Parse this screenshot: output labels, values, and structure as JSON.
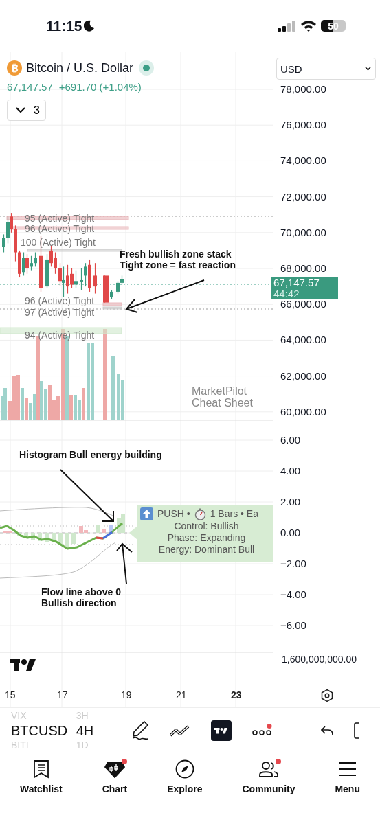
{
  "status_bar": {
    "time": "11:15",
    "battery": "50"
  },
  "symbol": {
    "title": "Bitcoin / U.S. Dollar",
    "market_open": true,
    "price": "67,147.57",
    "change": "+691.70 (+1.04%)",
    "indicator_count": "3",
    "currency": "USD"
  },
  "price_axis": [
    "78,000.00",
    "76,000.00",
    "74,000.00",
    "72,000.00",
    "70,000.00",
    "68,000.00",
    "66,000.00",
    "64,000.00",
    "62,000.00",
    "60,000.00"
  ],
  "last_price": {
    "price": "67,147.57",
    "countdown": "44:42"
  },
  "zones": [
    {
      "label": "95 (Active) Tight",
      "color": "#e8b4b8"
    },
    {
      "label": "96 (Active) Tight",
      "color": "#e8b4b8"
    },
    {
      "label": "100 (Active) Tight",
      "color": "#c9c9c9"
    },
    {
      "label": "96 (Active) Tight",
      "color": "#e8b4b8"
    },
    {
      "label": "97 (Active) Tight",
      "color": "#c9c9c9"
    },
    {
      "label": "94 (Active) Tight",
      "color": "#cfe8cc"
    }
  ],
  "annotations": [
    "Fresh bullish zone stack\nTight zone = fast reaction",
    "Histogram Bull energy building",
    "Flow line above 0\nBullish direction"
  ],
  "indicator_label": [
    "MarketPilot",
    "Cheat Sheet"
  ],
  "oscillator_axis": [
    "6.00",
    "4.00",
    "2.00",
    "0.00",
    "−2.00",
    "−4.00",
    "−6.00"
  ],
  "signal_box": {
    "signal": "PUSH •",
    "bars": "1 Bars • Ea",
    "lines": [
      "Control: Bullish",
      "Phase: Expanding",
      "Energy: Dominant Bull"
    ]
  },
  "volume_axis": "1,600,000,000.00",
  "time_axis": [
    {
      "label": "15",
      "bold": false
    },
    {
      "label": "17",
      "bold": false
    },
    {
      "label": "19",
      "bold": false
    },
    {
      "label": "21",
      "bold": false
    },
    {
      "label": "23",
      "bold": true
    }
  ],
  "toolbar": {
    "symbols": [
      {
        "label": "VIX",
        "selected": false
      },
      {
        "label": "BTCUSD",
        "selected": true
      },
      {
        "label": "BITI",
        "selected": false
      }
    ],
    "intervals": [
      {
        "label": "3H",
        "selected": false
      },
      {
        "label": "4H",
        "selected": true
      },
      {
        "label": "1D",
        "selected": false
      }
    ],
    "more_badge": true
  },
  "tabs": [
    {
      "label": "Watchlist",
      "selected": false,
      "badge": false
    },
    {
      "label": "Chart",
      "selected": true,
      "badge": true
    },
    {
      "label": "Explore",
      "selected": false,
      "badge": false
    },
    {
      "label": "Community",
      "selected": false,
      "badge": true
    },
    {
      "label": "Menu",
      "selected": false,
      "badge": false
    }
  ]
}
